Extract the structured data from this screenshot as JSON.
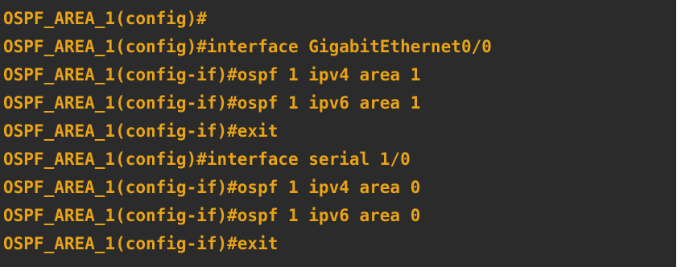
{
  "terminal": {
    "text_color": "#e8a317",
    "background_color": "#2b2b2b",
    "lines": [
      "OSPF_AREA_1(config)#",
      "OSPF_AREA_1(config)#interface GigabitEthernet0/0",
      "OSPF_AREA_1(config-if)#ospf 1 ipv4 area 1",
      "OSPF_AREA_1(config-if)#ospf 1 ipv6 area 1",
      "OSPF_AREA_1(config-if)#exit",
      "OSPF_AREA_1(config)#interface serial 1/0",
      "OSPF_AREA_1(config-if)#ospf 1 ipv4 area 0",
      "OSPF_AREA_1(config-if)#ospf 1 ipv6 area 0",
      "OSPF_AREA_1(config-if)#exit"
    ]
  }
}
